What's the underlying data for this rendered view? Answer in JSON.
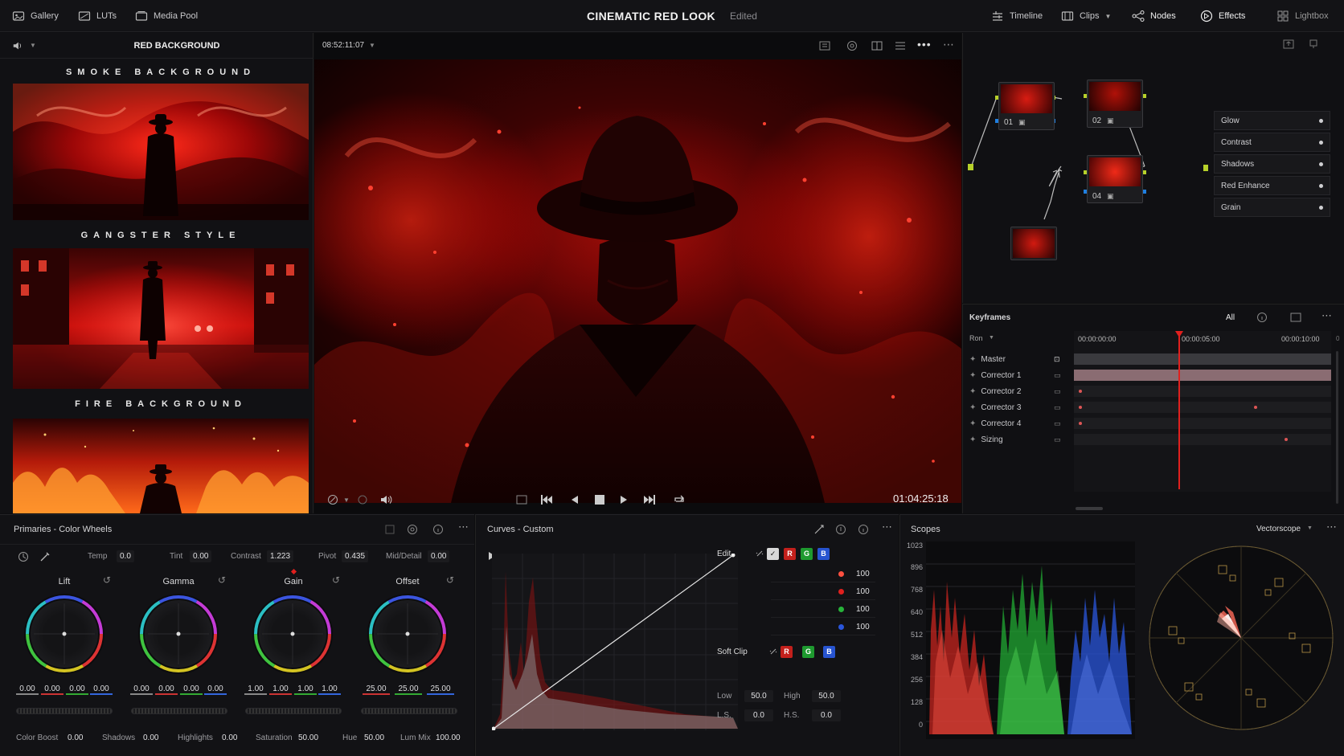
{
  "topbar": {
    "gallery": "Gallery",
    "luts": "LUTs",
    "media_pool": "Media Pool",
    "title": "CINEMATIC RED LOOK",
    "status": "Edited",
    "timeline": "Timeline",
    "clips": "Clips",
    "nodes": "Nodes",
    "effects": "Effects",
    "lightbox": "Lightbox"
  },
  "gallery": {
    "header": "RED BACKGROUND",
    "sections": [
      "SMOKE BACKGROUND",
      "GANGSTER STYLE",
      "FIRE BACKGROUND"
    ]
  },
  "viewer": {
    "timecode": "08:52:11:07",
    "playhead": "01:04:25:18"
  },
  "nodes": {
    "labels": [
      "01",
      "02",
      "04"
    ]
  },
  "effects": [
    "Glow",
    "Contrast",
    "Shadows",
    "Red Enhance",
    "Grain"
  ],
  "keyframes": {
    "title": "Keyframes",
    "filter": "All",
    "mode": "Ron",
    "times": [
      "00:00:00:00",
      "00:00:05:00",
      "00:00:10:00"
    ],
    "tracks": [
      "Master",
      "Corrector 1",
      "Corrector 2",
      "Corrector 3",
      "Corrector 4",
      "Sizing"
    ]
  },
  "primaries": {
    "title": "Primaries - Color Wheels",
    "temp_label": "Temp",
    "temp": "0.0",
    "tint_label": "Tint",
    "tint": "0.00",
    "contrast_label": "Contrast",
    "contrast": "1.223",
    "pivot_label": "Pivot",
    "pivot": "0.435",
    "middetail_label": "Mid/Detail",
    "middetail": "0.00",
    "wheels": [
      {
        "name": "Lift",
        "vals": [
          "0.00",
          "0.00",
          "0.00",
          "0.00"
        ]
      },
      {
        "name": "Gamma",
        "vals": [
          "0.00",
          "0.00",
          "0.00",
          "0.00"
        ]
      },
      {
        "name": "Gain",
        "vals": [
          "1.00",
          "1.00",
          "1.00",
          "1.00"
        ]
      },
      {
        "name": "Offset",
        "vals": [
          "25.00",
          "25.00",
          "25.00"
        ]
      }
    ],
    "bottom": {
      "colorboost_label": "Color Boost",
      "colorboost": "0.00",
      "shadows_label": "Shadows",
      "shadows": "0.00",
      "highlights_label": "Highlights",
      "highlights": "0.00",
      "saturation_label": "Saturation",
      "saturation": "50.00",
      "hue_label": "Hue",
      "hue": "50.00",
      "lummix_label": "Lum Mix",
      "lummix": "100.00"
    }
  },
  "curves": {
    "title": "Curves - Custom",
    "edit_label": "Edit",
    "channel_vals": [
      "100",
      "100",
      "100",
      "100"
    ],
    "softclip_label": "Soft Clip",
    "low_label": "Low",
    "low": "50.0",
    "high_label": "High",
    "high": "50.0",
    "ls_label": "L.S.",
    "ls": "0.0",
    "hs_label": "H.S.",
    "hs": "0.0",
    "chip_r": "R",
    "chip_g": "G",
    "chip_b": "B"
  },
  "scopes": {
    "title": "Scopes",
    "mode": "Vectorscope",
    "ylabels": [
      "1023",
      "896",
      "768",
      "640",
      "512",
      "384",
      "256",
      "128",
      "0"
    ]
  },
  "colors": {
    "accent_red": "#e0201e",
    "bg": "#0e0e10"
  }
}
